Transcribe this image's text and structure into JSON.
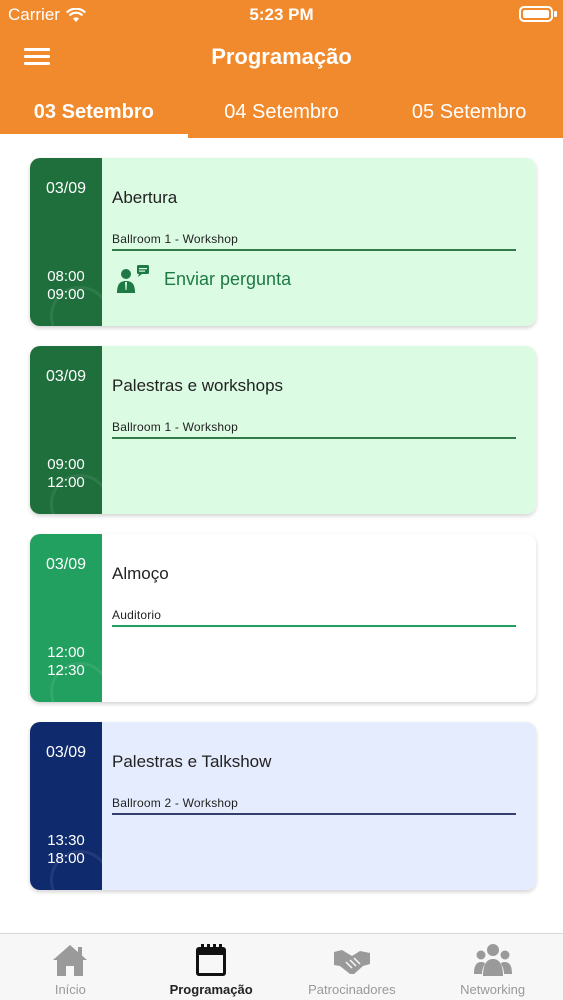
{
  "status": {
    "carrier": "Carrier",
    "time": "5:23 PM"
  },
  "header": {
    "title": "Programação"
  },
  "tabs": [
    {
      "label": "03 Setembro",
      "active": true
    },
    {
      "label": "04 Setembro",
      "active": false
    },
    {
      "label": "05 Setembro",
      "active": false
    }
  ],
  "events": [
    {
      "date": "03/09",
      "start": "08:00",
      "end": "09:00",
      "title": "Abertura",
      "room": "Ballroom 1 - Workshop",
      "action": "Enviar pergunta",
      "side_color": "#1e6f3b",
      "body_color": "#dcfbe3",
      "line_color": "#2f7a46"
    },
    {
      "date": "03/09",
      "start": "09:00",
      "end": "12:00",
      "title": "Palestras e workshops",
      "room": "Ballroom 1 - Workshop",
      "side_color": "#1e6f3b",
      "body_color": "#dcfbe3",
      "line_color": "#2f7a46"
    },
    {
      "date": "03/09",
      "start": "12:00",
      "end": "12:30",
      "title": "Almoço",
      "room": "Auditorio",
      "side_color": "#22a060",
      "body_color": "#ffffff",
      "line_color": "#22a060"
    },
    {
      "date": "03/09",
      "start": "13:30",
      "end": "18:00",
      "title": "Palestras e Talkshow",
      "room": "Ballroom 2 - Workshop",
      "side_color": "#102a6e",
      "body_color": "#e5ecfd",
      "line_color": "#33406b"
    }
  ],
  "nav": [
    {
      "label": "Início",
      "icon": "home-icon",
      "active": false
    },
    {
      "label": "Programação",
      "icon": "calendar-icon",
      "active": true
    },
    {
      "label": "Patrocinadores",
      "icon": "handshake-icon",
      "active": false
    },
    {
      "label": "Networking",
      "icon": "people-icon",
      "active": false
    }
  ],
  "colors": {
    "brand": "#f08a2c"
  }
}
